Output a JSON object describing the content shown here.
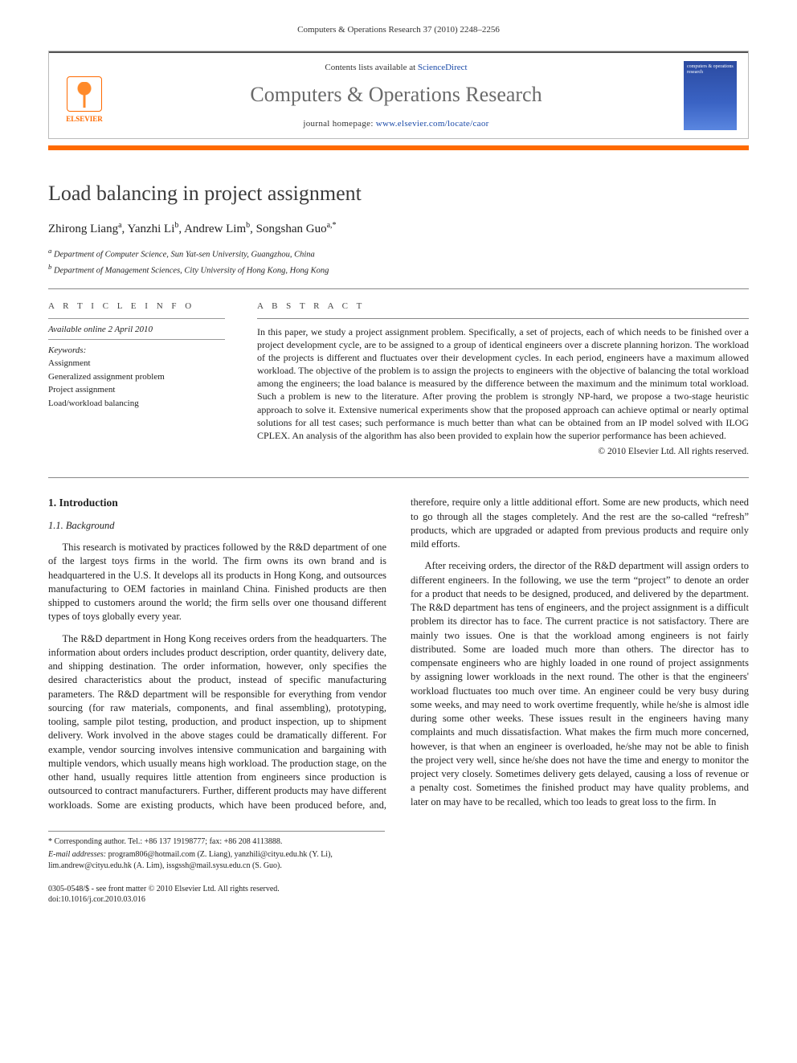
{
  "running_head": "Computers & Operations Research 37 (2010) 2248–2256",
  "banner": {
    "contents_prefix": "Contents lists available at ",
    "contents_link": "ScienceDirect",
    "journal_name": "Computers & Operations Research",
    "homepage_prefix": "journal homepage: ",
    "homepage_url": "www.elsevier.com/locate/caor",
    "publisher_logo_text": "ELSEVIER",
    "cover_text_top": "computers & operations research",
    "cover_text_bottom": ""
  },
  "article": {
    "title": "Load balancing in project assignment",
    "authors_html": "Zhirong Liang ᵃ, Yanzhi Li ᵇ, Andrew Lim ᵇ, Songshan Guo ᵃ,*",
    "authors": [
      {
        "name": "Zhirong Liang",
        "affil": "a"
      },
      {
        "name": "Yanzhi Li",
        "affil": "b"
      },
      {
        "name": "Andrew Lim",
        "affil": "b"
      },
      {
        "name": "Songshan Guo",
        "affil": "a,*"
      }
    ],
    "affiliations": {
      "a": "Department of Computer Science, Sun Yat-sen University, Guangzhou, China",
      "b": "Department of Management Sciences, City University of Hong Kong, Hong Kong"
    }
  },
  "info": {
    "label": "A R T I C L E   I N F O",
    "online": "Available online 2 April 2010",
    "kw_label": "Keywords:",
    "keywords": [
      "Assignment",
      "Generalized assignment problem",
      "Project assignment",
      "Load/workload balancing"
    ]
  },
  "abstract": {
    "label": "A B S T R A C T",
    "text": "In this paper, we study a project assignment problem. Specifically, a set of projects, each of which needs to be finished over a project development cycle, are to be assigned to a group of identical engineers over a discrete planning horizon. The workload of the projects is different and fluctuates over their development cycles. In each period, engineers have a maximum allowed workload. The objective of the problem is to assign the projects to engineers with the objective of balancing the total workload among the engineers; the load balance is measured by the difference between the maximum and the minimum total workload. Such a problem is new to the literature. After proving the problem is strongly NP-hard, we propose a two-stage heuristic approach to solve it. Extensive numerical experiments show that the proposed approach can achieve optimal or nearly optimal solutions for all test cases; such performance is much better than what can be obtained from an IP model solved with ILOG CPLEX. An analysis of the algorithm has also been provided to explain how the superior performance has been achieved.",
    "copyright": "© 2010 Elsevier Ltd. All rights reserved."
  },
  "body": {
    "h_intro": "1. Introduction",
    "h_background": "1.1. Background",
    "p1": "This research is motivated by practices followed by the R&D department of one of the largest toys firms in the world. The firm owns its own brand and is headquartered in the U.S. It develops all its products in Hong Kong, and outsources manufacturing to OEM factories in mainland China. Finished products are then shipped to customers around the world; the firm sells over one thousand different types of toys globally every year.",
    "p2": "The R&D department in Hong Kong receives orders from the headquarters. The information about orders includes product description, order quantity, delivery date, and shipping destination. The order information, however, only specifies the desired characteristics about the product, instead of specific manufacturing parameters. The R&D department will be responsible for everything from vendor sourcing (for raw materials, components, and final assembling), prototyping, tooling, sample pilot testing, production, and product inspection, up to shipment delivery. Work involved in the above stages could be dramatically different. For example, vendor sourcing involves intensive communication and bargaining with multiple vendors, which usually means high workload. The production stage, on the other hand, usually requires little attention from engineers since production is outsourced to contract manufacturers. Further, different products may have different workloads. Some are existing products, which have been produced before, and, therefore, require only a little additional effort. Some are new products, which need to go through all the stages completely. And the rest are the so-called “refresh” products, which are upgraded or adapted from previous products and require only mild efforts.",
    "p3": "After receiving orders, the director of the R&D department will assign orders to different engineers. In the following, we use the term “project” to denote an order for a product that needs to be designed, produced, and delivered by the department. The R&D department has tens of engineers, and the project assignment is a difficult problem its director has to face. The current practice is not satisfactory. There are mainly two issues. One is that the workload among engineers is not fairly distributed. Some are loaded much more than others. The director has to compensate engineers who are highly loaded in one round of project assignments by assigning lower workloads in the next round. The other is that the engineers' workload fluctuates too much over time. An engineer could be very busy during some weeks, and may need to work overtime frequently, while he/she is almost idle during some other weeks. These issues result in the engineers having many complaints and much dissatisfaction. What makes the firm much more concerned, however, is that when an engineer is overloaded, he/she may not be able to finish the project very well, since he/she does not have the time and energy to monitor the project very closely. Sometimes delivery gets delayed, causing a loss of revenue or a penalty cost. Sometimes the finished product may have quality problems, and later on may have to be recalled, which too leads to great loss to the firm. In"
  },
  "footnotes": {
    "corr": "* Corresponding author. Tel.: +86 137 19198777; fax: +86 208 4113888.",
    "email_label": "E-mail addresses:",
    "emails": " program806@hotmail.com (Z. Liang), yanzhili@cityu.edu.hk (Y. Li), lim.andrew@cityu.edu.hk (A. Lim), issgssh@mail.sysu.edu.cn (S. Guo)."
  },
  "bottom": {
    "line1": "0305-0548/$ - see front matter © 2010 Elsevier Ltd. All rights reserved.",
    "line2": "doi:10.1016/j.cor.2010.03.016"
  }
}
